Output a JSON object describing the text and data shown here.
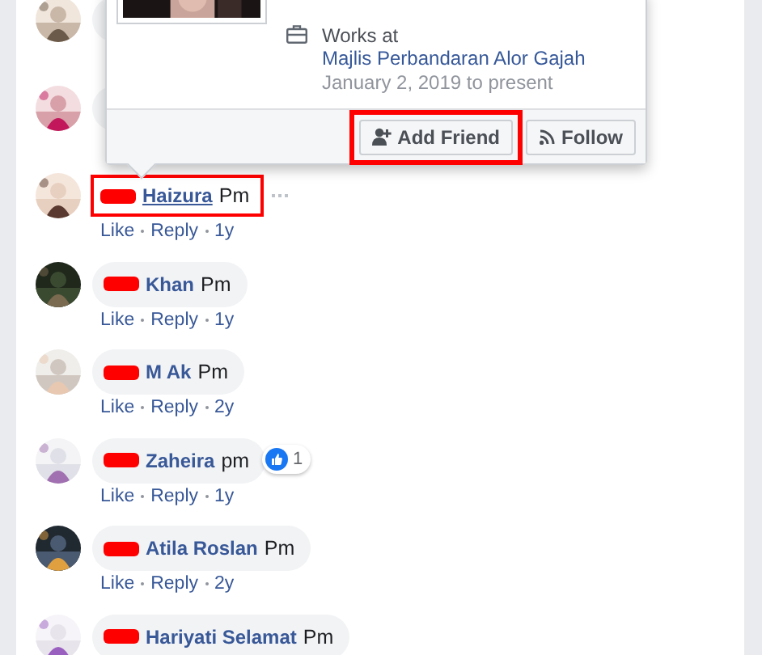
{
  "popup": {
    "work_prefix": "Works at ",
    "work_place": "Majlis Perbandaran Alor Gajah",
    "work_dates": "January 2, 2019 to present",
    "buttons": [
      {
        "label": "Add Friend",
        "kind": "add-friend",
        "highlighted": true
      },
      {
        "label": "Follow",
        "kind": "follow",
        "highlighted": false
      }
    ]
  },
  "comments": [
    {
      "kind": "covered"
    },
    {
      "kind": "covered"
    },
    {
      "kind": "comment",
      "redacted": true,
      "name": "Haizura",
      "text": "Pm",
      "hovered": true,
      "highlighted": true,
      "actions": [
        "Like",
        "Reply",
        "1y"
      ]
    },
    {
      "kind": "comment",
      "redacted": true,
      "name": "Khan",
      "text": "Pm",
      "hovered": false,
      "highlighted": false,
      "actions": [
        "Like",
        "Reply",
        "1y"
      ]
    },
    {
      "kind": "comment",
      "redacted": true,
      "name": "M Ak",
      "text": "Pm",
      "hovered": false,
      "highlighted": false,
      "actions": [
        "Like",
        "Reply",
        "2y"
      ]
    },
    {
      "kind": "comment",
      "redacted": true,
      "name": "Zaheira",
      "text": "pm",
      "hovered": false,
      "highlighted": false,
      "reactions": "1",
      "actions": [
        "Like",
        "Reply",
        "1y"
      ]
    },
    {
      "kind": "comment",
      "redacted": true,
      "name": "Atila Roslan",
      "text": "Pm",
      "hovered": false,
      "highlighted": false,
      "actions": [
        "Like",
        "Reply",
        "2y"
      ]
    },
    {
      "kind": "comment",
      "redacted": true,
      "name": "Hariyati Selamat",
      "text": "Pm",
      "hovered": false,
      "highlighted": false
    }
  ]
}
